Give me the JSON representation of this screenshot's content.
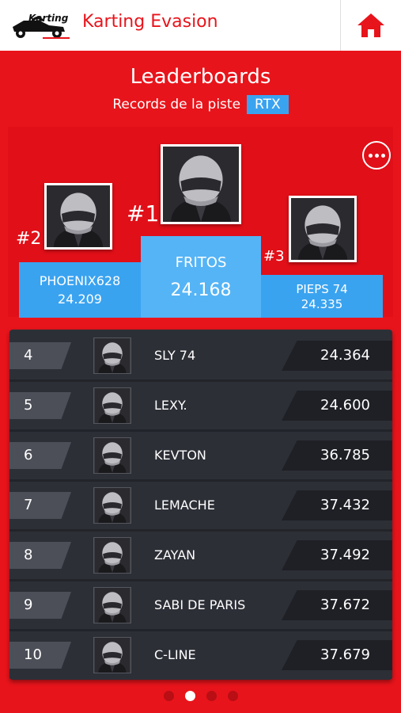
{
  "header": {
    "logo_text": "Karting",
    "title": "Karting Evasion",
    "home_icon": "home-icon"
  },
  "page": {
    "title": "Leaderboards",
    "subtitle": "Records de la piste",
    "track_badge": "RTX",
    "more_icon": "more-options-icon"
  },
  "podium": {
    "first": {
      "rank": "#1",
      "name": "FRITOS",
      "time": "24.168"
    },
    "second": {
      "rank": "#2",
      "name": "PHOENIX628",
      "time": "24.209"
    },
    "third": {
      "rank": "#3",
      "name": "PIEPS 74",
      "time": "24.335"
    }
  },
  "leaderboard": [
    {
      "pos": "4",
      "name": "SLY 74",
      "time": "24.364"
    },
    {
      "pos": "5",
      "name": "LEXY.",
      "time": "24.600"
    },
    {
      "pos": "6",
      "name": "KEVTON",
      "time": "36.785"
    },
    {
      "pos": "7",
      "name": "LEMACHE",
      "time": "37.432"
    },
    {
      "pos": "8",
      "name": "ZAYAN",
      "time": "37.492"
    },
    {
      "pos": "9",
      "name": "SABI DE PARIS",
      "time": "37.672"
    },
    {
      "pos": "10",
      "name": "C-LINE",
      "time": "37.679"
    }
  ],
  "pagination": {
    "count": 4,
    "active": 2
  },
  "colors": {
    "brand_red": "#e8141b",
    "accent_blue": "#3aa3f0",
    "list_bg": "#2d2f37"
  }
}
